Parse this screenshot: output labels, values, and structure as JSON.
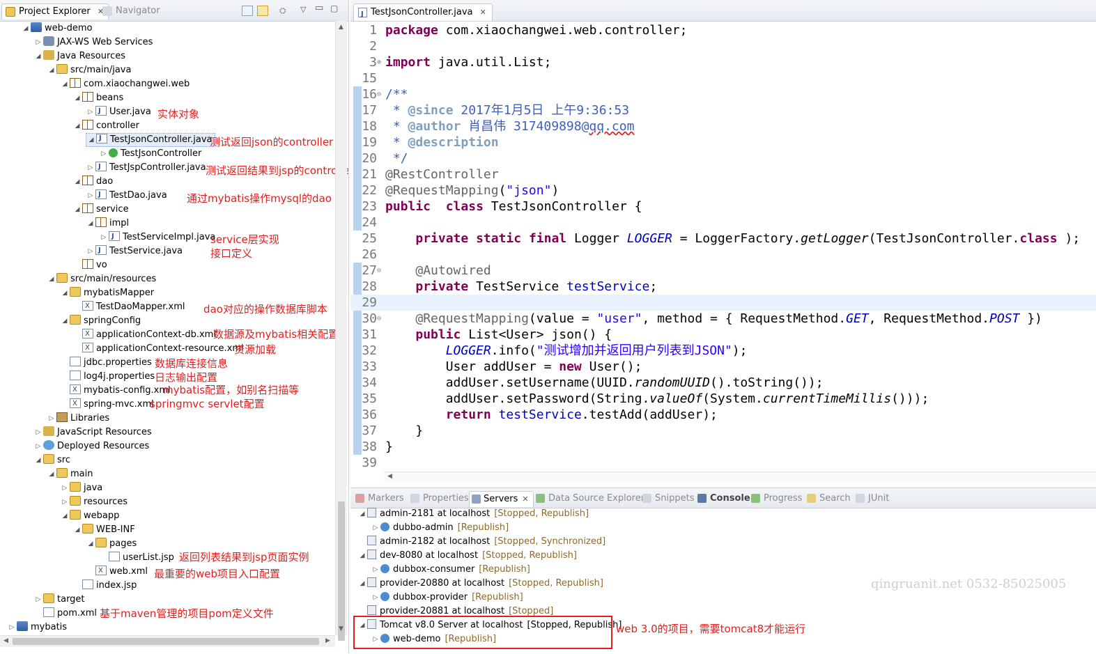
{
  "left_tabs": {
    "project_explorer": "Project Explorer",
    "navigator": "Navigator"
  },
  "tree": [
    {
      "label": "web-demo"
    },
    {
      "label": "JAX-WS Web Services"
    },
    {
      "label": "Java Resources"
    },
    {
      "label": "src/main/java"
    },
    {
      "label": "com.xiaochangwei.web"
    },
    {
      "label": "beans"
    },
    {
      "label": "User.java"
    },
    {
      "label": "controller"
    },
    {
      "label": "TestJsonController.java"
    },
    {
      "label": "TestJsonController"
    },
    {
      "label": "TestJspController.java"
    },
    {
      "label": "dao"
    },
    {
      "label": "TestDao.java"
    },
    {
      "label": "service"
    },
    {
      "label": "impl"
    },
    {
      "label": "TestServiceImpl.java"
    },
    {
      "label": "TestService.java"
    },
    {
      "label": "vo"
    },
    {
      "label": "src/main/resources"
    },
    {
      "label": "mybatisMapper"
    },
    {
      "label": "TestDaoMapper.xml"
    },
    {
      "label": "springConfig"
    },
    {
      "label": "applicationContext-db.xml"
    },
    {
      "label": "applicationContext-resource.xml"
    },
    {
      "label": "jdbc.properties"
    },
    {
      "label": "log4j.properties"
    },
    {
      "label": "mybatis-config.xml"
    },
    {
      "label": "spring-mvc.xml"
    },
    {
      "label": "Libraries"
    },
    {
      "label": "JavaScript Resources"
    },
    {
      "label": "Deployed Resources"
    },
    {
      "label": "src"
    },
    {
      "label": "main"
    },
    {
      "label": "java"
    },
    {
      "label": "resources"
    },
    {
      "label": "webapp"
    },
    {
      "label": "WEB-INF"
    },
    {
      "label": "pages"
    },
    {
      "label": "userList.jsp"
    },
    {
      "label": "web.xml"
    },
    {
      "label": "index.jsp"
    },
    {
      "label": "target"
    },
    {
      "label": "pom.xml"
    },
    {
      "label": "mybatis"
    }
  ],
  "notes": {
    "user_java": "实体对象",
    "test_json_controller": "测试返回json的controller",
    "test_jsp_controller": "测试返回结果到jsp的controller",
    "test_dao": "通过mybatis操作mysql的dao",
    "service_impl": "service层实现",
    "service_interface": "接口定义",
    "mapper_xml": "dao对应的操作数据库脚本",
    "context_db": "数据源及mybatis相关配置",
    "context_resource": "资源加载",
    "jdbc": "数据库连接信息",
    "log4j": "日志输出配置",
    "mybatis_config": "mybatis配置，如别名扫描等",
    "spring_mvc": "springmvc servlet配置",
    "userlist": "返回列表结果到jsp页面实例",
    "webxml": "最重要的web项目入口配置",
    "pom": "基于maven管理的项目pom定义文件",
    "tomcat": "web 3.0的项目，需要tomcat8才能运行"
  },
  "editor": {
    "tab_title": "TestJsonController.java",
    "lines": [
      {
        "n": "1",
        "segs": [
          [
            "kw",
            "package"
          ],
          [
            "",
            "com.xiaochangwei.web.controller;"
          ]
        ]
      },
      {
        "n": "2",
        "segs": []
      },
      {
        "n": "3",
        "segs": [
          [
            "kw",
            "import"
          ],
          [
            "",
            "java.util.List;"
          ]
        ]
      },
      {
        "n": "15",
        "segs": []
      },
      {
        "n": "16",
        "segs": [
          [
            "jd",
            "/**"
          ]
        ]
      },
      {
        "n": "17",
        "segs": [
          [
            "jd",
            " * "
          ],
          [
            "jdtag",
            "@since"
          ],
          [
            "jd",
            " 2017年1月5日 上午9:36:53"
          ]
        ]
      },
      {
        "n": "18",
        "segs": [
          [
            "jd",
            " * "
          ],
          [
            "jdtag",
            "@author"
          ],
          [
            "jd",
            " 肖昌伟 317409898@qq.com"
          ]
        ]
      },
      {
        "n": "19",
        "segs": [
          [
            "jd",
            " * "
          ],
          [
            "jdtag",
            "@description"
          ]
        ]
      },
      {
        "n": "20",
        "segs": [
          [
            "jd",
            " */"
          ]
        ]
      },
      {
        "n": "21",
        "segs": [
          [
            "ann",
            "@RestController"
          ]
        ]
      },
      {
        "n": "22",
        "segs": [
          [
            "ann",
            "@RequestMapping"
          ],
          [
            "",
            "("
          ],
          [
            "str",
            "\"json\""
          ],
          [
            "",
            ")"
          ]
        ]
      },
      {
        "n": "23",
        "segs": [
          [
            "kw",
            "public"
          ],
          [
            "",
            ""
          ],
          [
            "kw",
            "class"
          ],
          [
            "",
            "TestJsonController {"
          ]
        ]
      },
      {
        "n": "24",
        "segs": []
      },
      {
        "n": "25",
        "segs": [
          [
            "",
            "    "
          ],
          [
            "kw",
            "private"
          ],
          [
            "kw",
            "static"
          ],
          [
            "kw",
            "final"
          ],
          [
            "",
            "Logger"
          ],
          [
            "sfld",
            "LOGGER"
          ],
          [
            "",
            "= LoggerFactory."
          ],
          [
            "smeth",
            "getLogger"
          ],
          [
            "",
            "(TestJsonController."
          ],
          [
            "kw",
            "class"
          ],
          [
            "",
            ");"
          ]
        ]
      },
      {
        "n": "26",
        "segs": []
      },
      {
        "n": "27",
        "segs": [
          [
            "",
            "    "
          ],
          [
            "ann",
            "@Autowired"
          ]
        ]
      },
      {
        "n": "28",
        "segs": [
          [
            "",
            "    "
          ],
          [
            "kw",
            "private"
          ],
          [
            "",
            "TestService"
          ],
          [
            "fld",
            "testService"
          ],
          [
            "",
            ";"
          ]
        ]
      },
      {
        "n": "29",
        "segs": []
      },
      {
        "n": "30",
        "segs": [
          [
            "",
            "    "
          ],
          [
            "ann",
            "@RequestMapping"
          ],
          [
            "",
            "(value = "
          ],
          [
            "str",
            "\"user\""
          ],
          [
            "",
            ", method = { RequestMethod."
          ],
          [
            "sfld",
            "GET"
          ],
          [
            "",
            ", RequestMethod."
          ],
          [
            "sfld",
            "POST"
          ],
          [
            "",
            ""
          ],
          [
            "",
            "})"
          ]
        ]
      },
      {
        "n": "31",
        "segs": [
          [
            "",
            "    "
          ],
          [
            "kw",
            "public"
          ],
          [
            "",
            "List<User> json() {"
          ]
        ]
      },
      {
        "n": "32",
        "segs": [
          [
            "",
            "        "
          ],
          [
            "sfld",
            "LOGGER"
          ],
          [
            "",
            ".info("
          ],
          [
            "str",
            "\"测试增加并返回用户列表到JSON\""
          ],
          [
            "",
            ");"
          ]
        ]
      },
      {
        "n": "33",
        "segs": [
          [
            "",
            "        User addUser = "
          ],
          [
            "kw",
            "new"
          ],
          [
            "",
            "User();"
          ]
        ]
      },
      {
        "n": "34",
        "segs": [
          [
            "",
            "        addUser.setUsername(UUID."
          ],
          [
            "smeth",
            "randomUUID"
          ],
          [
            "",
            "().toString());"
          ]
        ]
      },
      {
        "n": "35",
        "segs": [
          [
            "",
            "        addUser.setPassword(String."
          ],
          [
            "smeth",
            "valueOf"
          ],
          [
            "",
            "(System."
          ],
          [
            "smeth",
            "currentTimeMillis"
          ],
          [
            "",
            "()));"
          ]
        ]
      },
      {
        "n": "36",
        "segs": [
          [
            "",
            "        "
          ],
          [
            "kw",
            "return"
          ],
          [
            "fld",
            "testService"
          ],
          [
            "",
            ".testAdd(addUser);"
          ]
        ]
      },
      {
        "n": "37",
        "segs": [
          [
            "",
            "    }"
          ]
        ]
      },
      {
        "n": "38",
        "segs": [
          [
            "",
            "}"
          ]
        ]
      },
      {
        "n": "39",
        "segs": []
      }
    ]
  },
  "bottom_tabs": [
    "Markers",
    "Properties",
    "Servers",
    "Data Source Explorer",
    "Snippets",
    "Console",
    "Progress",
    "Search",
    "JUnit"
  ],
  "servers": [
    {
      "name": "admin-2181 at localhost",
      "state": "[Stopped, Republish]"
    },
    {
      "name": "dubbo-admin",
      "state": "[Republish]"
    },
    {
      "name": "admin-2182 at localhost",
      "state": "[Stopped, Synchronized]"
    },
    {
      "name": "dev-8080 at localhost",
      "state": "[Stopped, Republish]"
    },
    {
      "name": "dubbox-consumer",
      "state": "[Republish]"
    },
    {
      "name": "provider-20880 at localhost",
      "state": "[Stopped, Republish]"
    },
    {
      "name": "dubbox-provider",
      "state": "[Republish]"
    },
    {
      "name": "provider-20881 at localhost",
      "state": "[Stopped]"
    },
    {
      "name": "Tomcat v8.0 Server at localhost",
      "state": "[Stopped, Republish]"
    },
    {
      "name": "web-demo",
      "state": "[Republish]"
    }
  ],
  "watermark": "qingruanit.net 0532-85025005",
  "colors": {
    "annotation_red": "#e02020",
    "keyword": "#7f0055",
    "string": "#2a00ff",
    "javadoc": "#3f5fbf",
    "field": "#0000c0"
  }
}
